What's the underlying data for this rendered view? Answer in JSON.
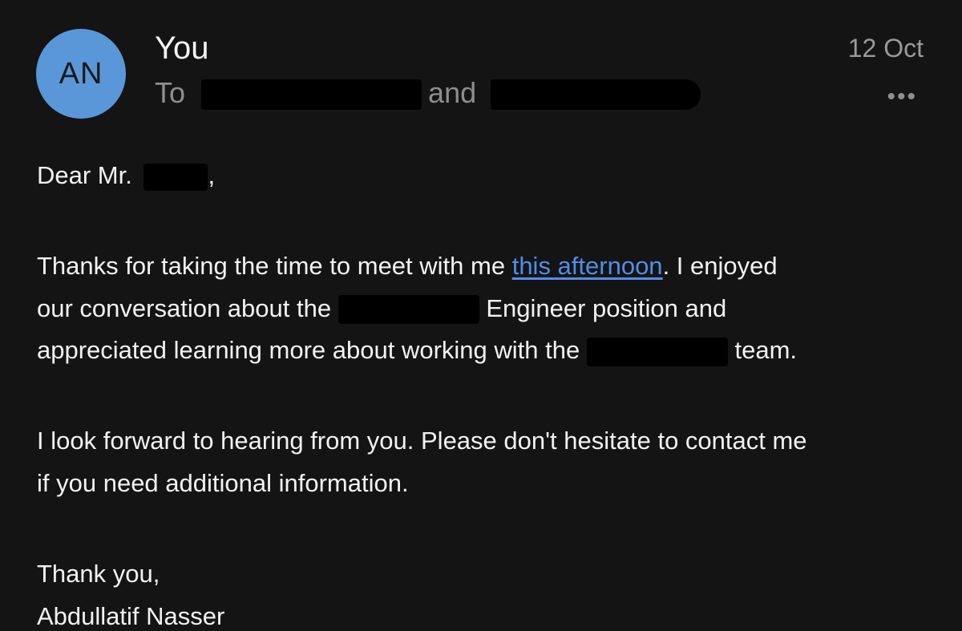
{
  "message": {
    "avatar_initials": "AN",
    "sender": "You",
    "date": "12 Oct",
    "to_prefix": "To",
    "to_joiner": "and",
    "more_label": "•••"
  },
  "body": {
    "greeting_prefix": "Dear Mr.",
    "greeting_suffix": ",",
    "p1_line1_a": "Thanks for taking the time to meet with me ",
    "p1_link": "this afternoon",
    "p1_line1_b": ". I enjoyed",
    "p1_line2_a": "our conversation about the ",
    "p1_line2_b": " Engineer position and",
    "p1_line3_a": "appreciated learning more about working with the ",
    "p1_line3_b": " team.",
    "p2_line1": "I look forward to hearing from you. Please don't hesitate to contact me",
    "p2_line2": "if you need additional information.",
    "closing": "Thank you,",
    "signature": "Abdullatif Nasser"
  },
  "colors": {
    "background": "#141414",
    "avatar": "#5a97d8",
    "link": "#4f8fe6"
  }
}
